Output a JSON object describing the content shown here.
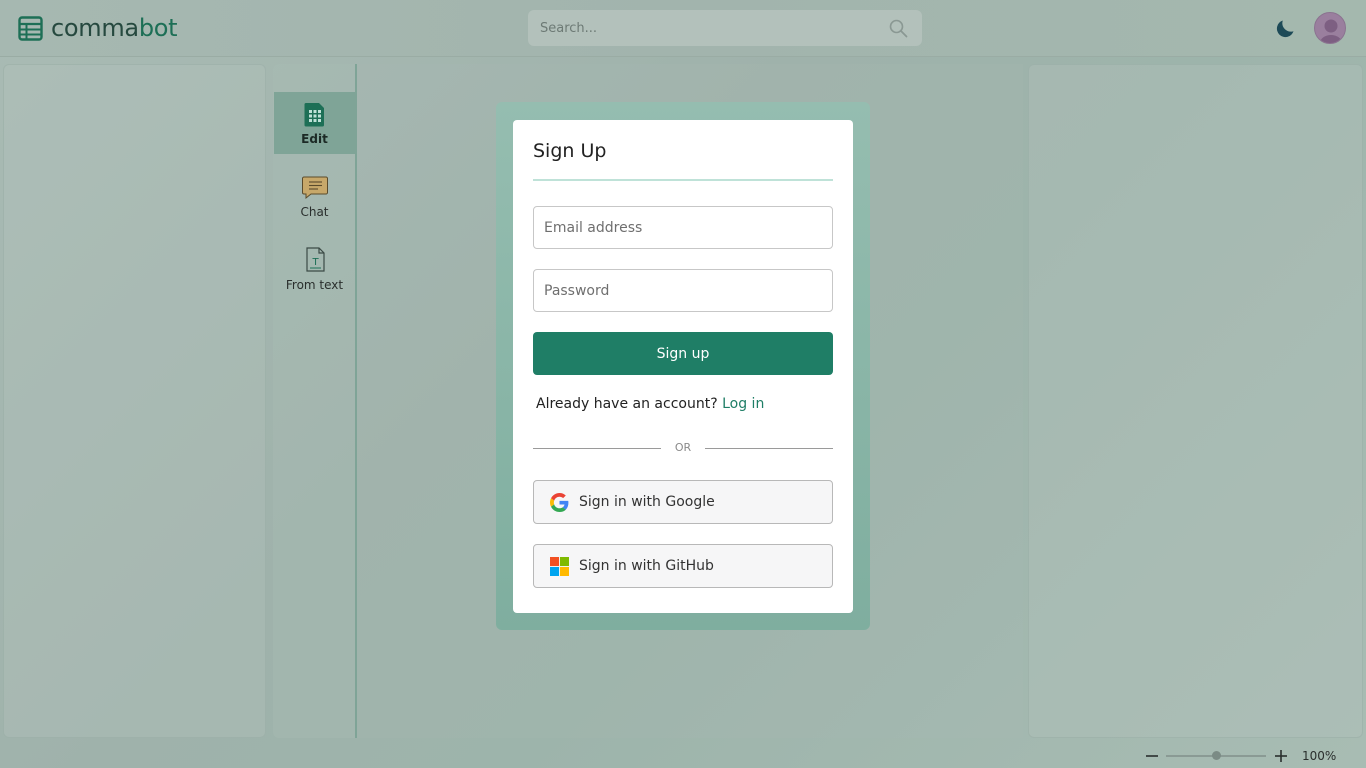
{
  "app": {
    "logo_text_main": "comma",
    "logo_text_accent": "bot",
    "logo_icon": "spreadsheet-icon"
  },
  "header": {
    "search_placeholder": "Search...",
    "search_icon": "search-icon",
    "theme_icon": "moon-icon",
    "avatar_icon": "user-avatar"
  },
  "tools": {
    "items": [
      {
        "label": "Edit",
        "icon": "spreadsheet-edit-icon",
        "active": true
      },
      {
        "label": "Chat",
        "icon": "chat-bubble-icon",
        "active": false
      },
      {
        "label": "From text",
        "icon": "text-document-icon",
        "active": false
      }
    ]
  },
  "signup": {
    "title": "Sign Up",
    "email_placeholder": "Email address",
    "password_placeholder": "Password",
    "submit_label": "Sign up",
    "login_prompt": "Already have an account?",
    "login_link": "Log in",
    "or_text": "OR",
    "google_label": "Sign in with Google",
    "github_label": "Sign in with GitHub"
  },
  "zoom": {
    "value": "100%",
    "level_fraction": 0.5
  },
  "colors": {
    "accent": "#1f7e66",
    "title_rule": "#bfe2d8"
  }
}
